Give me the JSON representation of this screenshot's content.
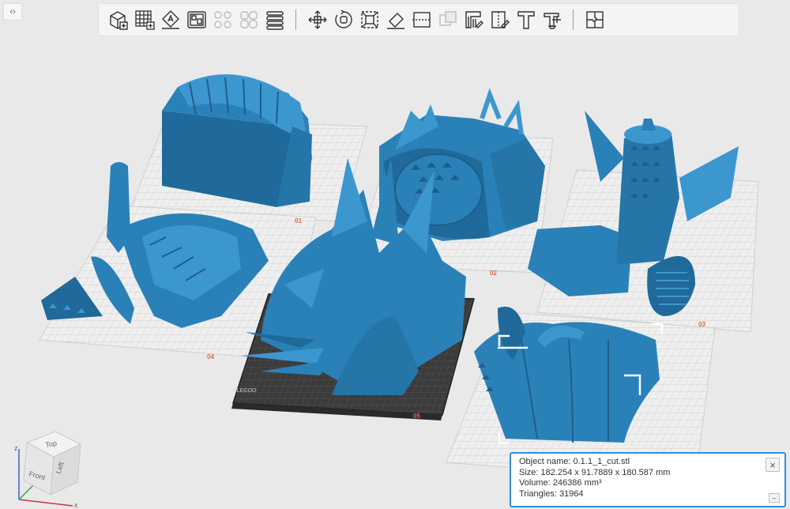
{
  "app": {
    "collapse_glyph": "‹›"
  },
  "toolbar": {
    "groups": [
      [
        {
          "name": "add-object",
          "icon": "cube-add-icon",
          "enabled": true
        },
        {
          "name": "add-plate",
          "icon": "grid-add-icon",
          "enabled": true
        },
        {
          "name": "auto-orient",
          "icon": "auto-orient-icon",
          "enabled": true
        },
        {
          "name": "arrange",
          "icon": "arrange-icon",
          "enabled": true
        },
        {
          "name": "split-objects",
          "icon": "split-objects-icon",
          "enabled": false
        },
        {
          "name": "split-parts",
          "icon": "split-parts-icon",
          "enabled": false
        },
        {
          "name": "layers",
          "icon": "layers-icon",
          "enabled": true
        }
      ],
      [
        {
          "name": "move",
          "icon": "move-icon",
          "enabled": true
        },
        {
          "name": "rotate",
          "icon": "rotate-icon",
          "enabled": true
        },
        {
          "name": "scale",
          "icon": "scale-icon",
          "enabled": true
        },
        {
          "name": "lay-on-face",
          "icon": "lay-on-face-icon",
          "enabled": true
        },
        {
          "name": "cut",
          "icon": "cut-icon",
          "enabled": true
        },
        {
          "name": "boolean",
          "icon": "boolean-icon",
          "enabled": false
        },
        {
          "name": "support-paint",
          "icon": "support-paint-icon",
          "enabled": true
        },
        {
          "name": "seam-paint",
          "icon": "seam-paint-icon",
          "enabled": true
        },
        {
          "name": "text",
          "icon": "text-icon",
          "enabled": true
        },
        {
          "name": "emboss",
          "icon": "emboss-icon",
          "enabled": true
        }
      ],
      [
        {
          "name": "assembly",
          "icon": "puzzle-icon",
          "enabled": true
        }
      ]
    ]
  },
  "plates": [
    {
      "label": "01"
    },
    {
      "label": "02"
    },
    {
      "label": "03"
    },
    {
      "label": "04"
    },
    {
      "label": "05"
    }
  ],
  "bed": {
    "brand": "ELEGOO"
  },
  "view_cube": {
    "top": "Top",
    "front": "Front",
    "left": "Left",
    "axis_x": "x",
    "axis_z": "z"
  },
  "object_info": {
    "name_label": "Object name: ",
    "name_value": "0.1.1_1_cut.stl",
    "size_label": "Size: ",
    "size_value": "182.254 x 91.7889 x 180.587 mm",
    "volume_label": "Volume: ",
    "volume_value": "246386 mm³",
    "triangles_label": "Triangles: ",
    "triangles_value": "31964",
    "close_glyph": "×",
    "collapse_glyph": "–"
  },
  "colors": {
    "model": "#2a81b8",
    "model_dark": "#1f6a9a",
    "model_light": "#3d97cf",
    "plate_grid": "#cfcfcf",
    "bed_dark": "#3a3a3a",
    "accent": "#2d8fd6",
    "label": "#e06a3a"
  }
}
